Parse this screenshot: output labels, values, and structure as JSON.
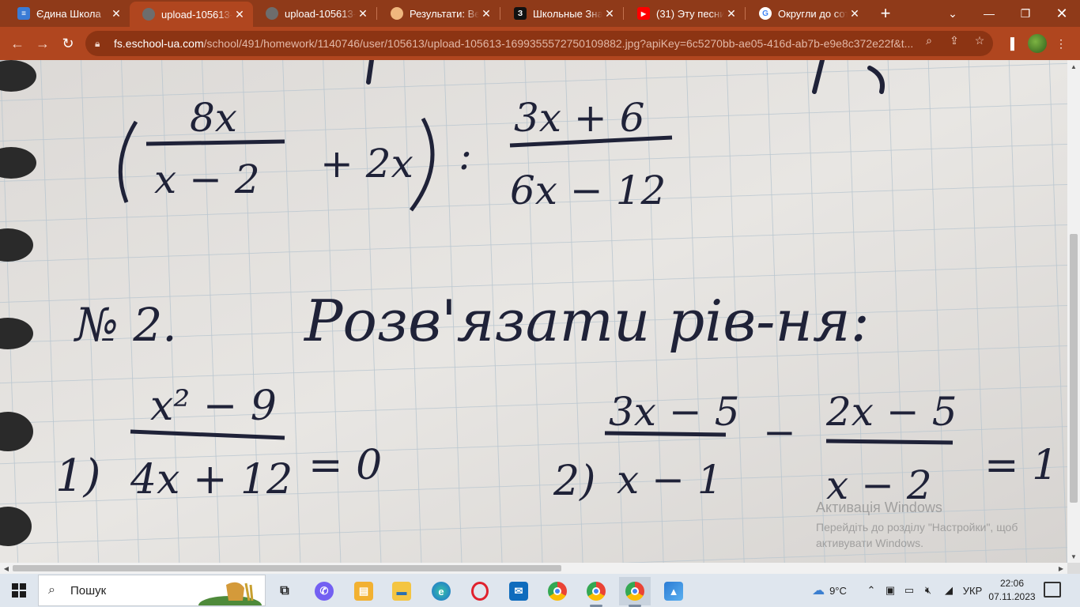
{
  "browser": {
    "tabs": [
      {
        "title": "Єдина Школа",
        "favicon": "eschool-icon",
        "active": false
      },
      {
        "title": "upload-105613-",
        "favicon": "globe-icon",
        "active": true
      },
      {
        "title": "upload-105613-",
        "favicon": "globe-icon",
        "active": false
      },
      {
        "title": "Результати: Вер",
        "favicon": "brain-icon",
        "active": false
      },
      {
        "title": "Школьные Знан",
        "favicon": "znanija-icon",
        "active": false
      },
      {
        "title": "(31) Эту песни д",
        "favicon": "youtube-icon",
        "active": false
      },
      {
        "title": "Округли до сот",
        "favicon": "google-icon",
        "active": false
      }
    ],
    "url_host": "fs.eschool-ua.com",
    "url_path": "/school/491/homework/1140746/user/105613/upload-105613-1699355572750109882.jpg?apiKey=6c5270bb-ae05-416d-ab7b-e9e8c372e22f&t..."
  },
  "notebook": {
    "expr_top_num": "8x",
    "expr_top_den": "x − 2",
    "expr_top_plus": "+ 2x",
    "expr_divide": ":",
    "expr_right_num": "3x + 6",
    "expr_right_den": "6x − 12",
    "task_number": "№ 2.",
    "task_title": "Розв'язати рів-ня:",
    "eq1_label": "1)",
    "eq1_num": "x² − 9",
    "eq1_den": "4x + 12",
    "eq1_rhs": "= 0",
    "eq2_label": "2)",
    "eq2_num1": "3x − 5",
    "eq2_den1": "x − 1",
    "eq2_minus": "−",
    "eq2_num2": "2x − 5",
    "eq2_den2": "x − 2",
    "eq2_rhs": "= 1"
  },
  "watermark": {
    "title": "Активація Windows",
    "subtitle": "Перейдіть до розділу \"Настройки\", щоб активувати Windows."
  },
  "taskbar": {
    "search_placeholder": "Пошук",
    "weather_temp": "9°C",
    "language": "УКР",
    "time": "22:06",
    "date": "07.11.2023"
  }
}
